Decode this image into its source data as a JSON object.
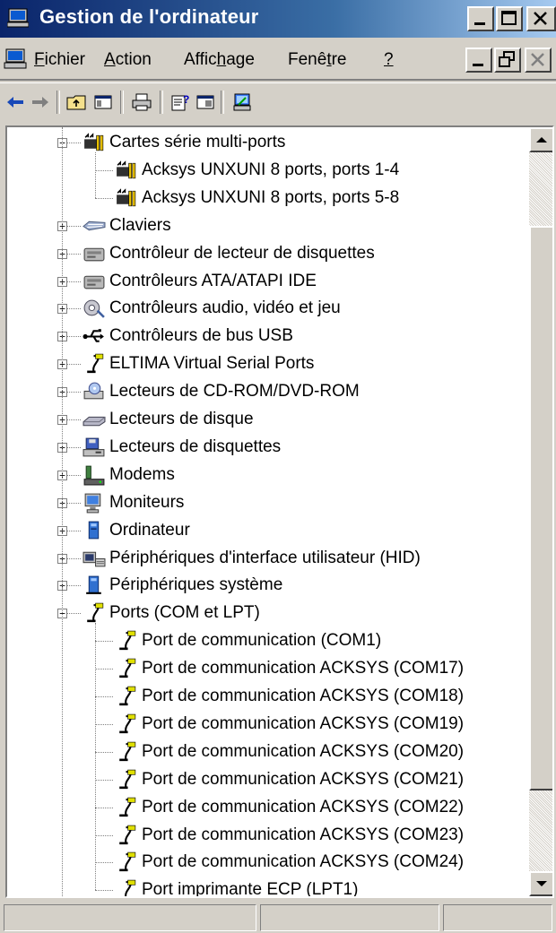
{
  "window": {
    "title": "Gestion de l'ordinateur",
    "title_icon": "computer-management-icon",
    "caption_buttons": [
      "minimize",
      "maximize",
      "close"
    ]
  },
  "menubar": {
    "items": [
      {
        "label": "Fichier",
        "accel": "F"
      },
      {
        "label": "Action",
        "accel": "A"
      },
      {
        "label": "Affichage",
        "accel": "h"
      },
      {
        "label": "Fenêtre",
        "accel": "t"
      },
      {
        "label": "?",
        "accel": "?"
      }
    ],
    "mdi_buttons": [
      "minimize",
      "restore",
      "close"
    ]
  },
  "toolbar": {
    "buttons": [
      "back-arrow-icon",
      "forward-arrow-icon",
      "up-folder-icon",
      "show-hide-tree-icon",
      "print-icon",
      "properties-icon",
      "help-icon",
      "update-driver-icon"
    ]
  },
  "tree": {
    "items": [
      {
        "label": "Cartes série multi-ports",
        "level": 1,
        "expander": "minus",
        "icon": "multiport-card-icon"
      },
      {
        "label": "Acksys UNXUNI 8 ports, ports 1-4",
        "level": 2,
        "expander": "none",
        "icon": "multiport-card-icon"
      },
      {
        "label": "Acksys UNXUNI 8 ports, ports 5-8",
        "level": 2,
        "expander": "none",
        "icon": "multiport-card-icon"
      },
      {
        "label": "Claviers",
        "level": 1,
        "expander": "plus",
        "icon": "keyboard-icon"
      },
      {
        "label": "Contrôleur de lecteur de disquettes",
        "level": 1,
        "expander": "plus",
        "icon": "controller-icon"
      },
      {
        "label": "Contrôleurs ATA/ATAPI IDE",
        "level": 1,
        "expander": "plus",
        "icon": "controller-icon"
      },
      {
        "label": "Contrôleurs audio, vidéo et jeu",
        "level": 1,
        "expander": "plus",
        "icon": "audio-icon"
      },
      {
        "label": "Contrôleurs de bus USB",
        "level": 1,
        "expander": "plus",
        "icon": "usb-icon"
      },
      {
        "label": "ELTIMA Virtual Serial Ports",
        "level": 1,
        "expander": "plus",
        "icon": "port-icon"
      },
      {
        "label": "Lecteurs de CD-ROM/DVD-ROM",
        "level": 1,
        "expander": "plus",
        "icon": "cdrom-icon"
      },
      {
        "label": "Lecteurs de disque",
        "level": 1,
        "expander": "plus",
        "icon": "disk-drive-icon"
      },
      {
        "label": "Lecteurs de disquettes",
        "level": 1,
        "expander": "plus",
        "icon": "floppy-icon"
      },
      {
        "label": "Modems",
        "level": 1,
        "expander": "plus",
        "icon": "modem-icon"
      },
      {
        "label": "Moniteurs",
        "level": 1,
        "expander": "plus",
        "icon": "monitor-icon"
      },
      {
        "label": "Ordinateur",
        "level": 1,
        "expander": "plus",
        "icon": "computer-icon"
      },
      {
        "label": "Périphériques d'interface utilisateur (HID)",
        "level": 1,
        "expander": "plus",
        "icon": "hid-icon"
      },
      {
        "label": "Périphériques système",
        "level": 1,
        "expander": "plus",
        "icon": "system-device-icon"
      },
      {
        "label": "Ports (COM et LPT)",
        "level": 1,
        "expander": "minus",
        "icon": "port-icon"
      },
      {
        "label": "Port de communication (COM1)",
        "level": 2,
        "expander": "none",
        "icon": "port-icon"
      },
      {
        "label": "Port de communication ACKSYS (COM17)",
        "level": 2,
        "expander": "none",
        "icon": "port-icon"
      },
      {
        "label": "Port de communication ACKSYS (COM18)",
        "level": 2,
        "expander": "none",
        "icon": "port-icon"
      },
      {
        "label": "Port de communication ACKSYS (COM19)",
        "level": 2,
        "expander": "none",
        "icon": "port-icon"
      },
      {
        "label": "Port de communication ACKSYS (COM20)",
        "level": 2,
        "expander": "none",
        "icon": "port-icon"
      },
      {
        "label": "Port de communication ACKSYS (COM21)",
        "level": 2,
        "expander": "none",
        "icon": "port-icon"
      },
      {
        "label": "Port de communication ACKSYS (COM22)",
        "level": 2,
        "expander": "none",
        "icon": "port-icon"
      },
      {
        "label": "Port de communication ACKSYS (COM23)",
        "level": 2,
        "expander": "none",
        "icon": "port-icon"
      },
      {
        "label": "Port de communication ACKSYS (COM24)",
        "level": 2,
        "expander": "none",
        "icon": "port-icon"
      },
      {
        "label": "Port imprimante ECP (LPT1)",
        "level": 2,
        "expander": "none",
        "icon": "port-icon"
      }
    ]
  },
  "scrollbar": {
    "position_fraction": 0.1
  },
  "statusbar": {
    "panes": [
      "",
      "",
      ""
    ]
  },
  "colors": {
    "title_gradient_start": "#0a246a",
    "title_gradient_end": "#a6caf0",
    "face": "#d4d0c8",
    "tree_background": "#ffffff"
  }
}
